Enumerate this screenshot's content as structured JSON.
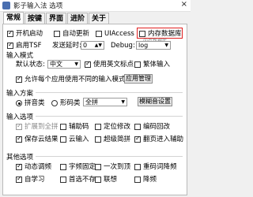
{
  "window": {
    "title": "影子输入法 选项",
    "close_symbol": "×"
  },
  "tabs": [
    {
      "label": "常规",
      "active": true
    },
    {
      "label": "按键",
      "active": false
    },
    {
      "label": "界面",
      "active": false
    },
    {
      "label": "进阶",
      "active": false
    },
    {
      "label": "关于",
      "active": false
    }
  ],
  "general": {
    "autostart": {
      "label": "开机启动",
      "checked": true
    },
    "autoupdate": {
      "label": "自动更新",
      "checked": false
    },
    "uiaccess": {
      "label": "UIAccess",
      "checked": false
    },
    "memory_db": {
      "label": "内存数据库",
      "checked": false
    },
    "tooltip": "内存数据库",
    "enable_tsf": {
      "label": "启用TSF",
      "checked": true
    },
    "delay_label": "发送延时:",
    "delay_value": "0",
    "debug_label": "Debug:",
    "debug_value": "log"
  },
  "input_mode": {
    "title": "输入模式",
    "default_state_label": "默认状态:",
    "default_state_value": "中文",
    "english_punct": {
      "label": "使用英文标点",
      "checked": true
    },
    "traditional": {
      "label": "繁体输入",
      "checked": false
    },
    "per_app": {
      "label": "允许每个应用使用不同的输入模式",
      "checked": true
    },
    "app_manage_button": "应用管理"
  },
  "input_scheme": {
    "title": "输入方案",
    "pinyin": {
      "label": "拼音类",
      "selected": true
    },
    "shape": {
      "label": "形码类",
      "selected": false
    },
    "scheme_value": "全拼",
    "fuzzy_button": "模糊音设置"
  },
  "input_options": {
    "title": "输入选项",
    "items": [
      {
        "label": "扩展到全拼",
        "checked": true,
        "disabled": true
      },
      {
        "label": "辅助码",
        "checked": false,
        "disabled": false
      },
      {
        "label": "定位修改",
        "checked": false,
        "disabled": false
      },
      {
        "label": "编码回改",
        "checked": false,
        "disabled": false
      },
      {
        "label": "保存云结果",
        "checked": true,
        "disabled": false
      },
      {
        "label": "云输入",
        "checked": false,
        "disabled": false
      },
      {
        "label": "超级简拼",
        "checked": false,
        "disabled": false
      },
      {
        "label": "翻页进入辅助",
        "checked": true,
        "disabled": false
      }
    ]
  },
  "other_options": {
    "title": "其他选项",
    "items": [
      {
        "label": "动态调频",
        "checked": true
      },
      {
        "label": "字频固定",
        "checked": false
      },
      {
        "label": "一次到顶",
        "checked": false
      },
      {
        "label": "重码词降频",
        "checked": false
      },
      {
        "label": "自学习",
        "checked": true
      },
      {
        "label": "首选不存",
        "checked": false
      },
      {
        "label": "联想",
        "checked": false
      },
      {
        "label": "降频",
        "checked": false
      }
    ]
  }
}
